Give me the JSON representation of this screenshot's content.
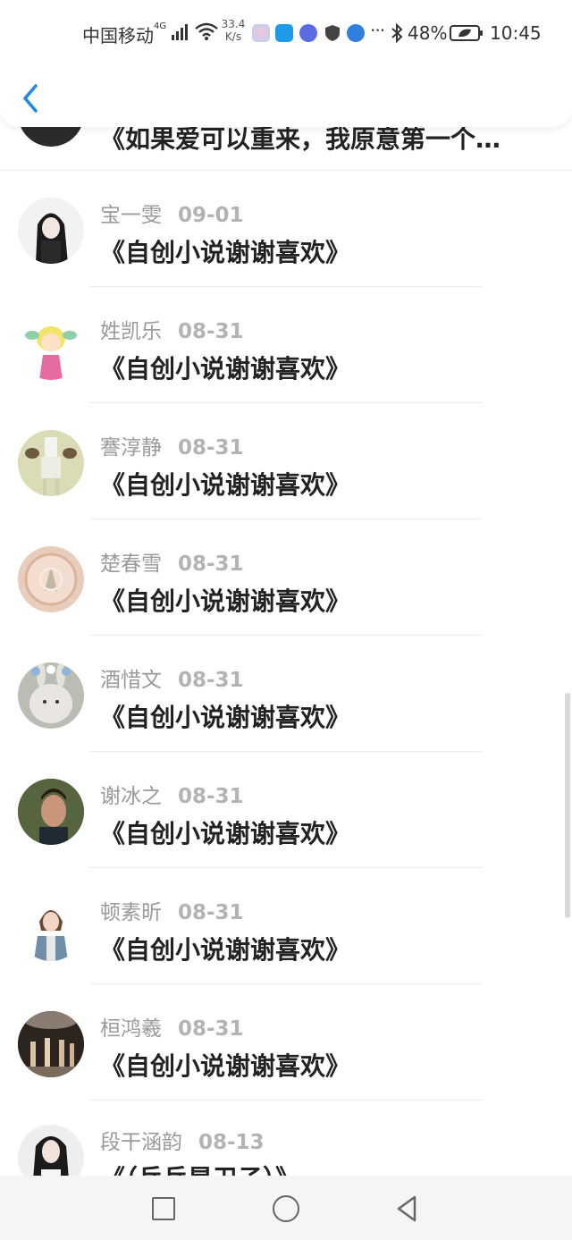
{
  "status_bar": {
    "carrier": "中国移动",
    "network_type": "4G",
    "net_speed_value": "33.4",
    "net_speed_unit": "K/s",
    "ellipsis": "···",
    "battery": "48%",
    "time": "10:45"
  },
  "header": {
    "back_icon": "chevron-left-icon"
  },
  "first_row": {
    "title": "《如果爱可以重来，我原意第一个…"
  },
  "rows": [
    {
      "name": "宝一雯",
      "date": "09-01",
      "title": "《自创小说谢谢喜欢》"
    },
    {
      "name": "姓凯乐",
      "date": "08-31",
      "title": "《自创小说谢谢喜欢》"
    },
    {
      "name": "謇淳静",
      "date": "08-31",
      "title": "《自创小说谢谢喜欢》"
    },
    {
      "name": "楚春雪",
      "date": "08-31",
      "title": "《自创小说谢谢喜欢》"
    },
    {
      "name": "酒惜文",
      "date": "08-31",
      "title": "《自创小说谢谢喜欢》"
    },
    {
      "name": "谢冰之",
      "date": "08-31",
      "title": "《自创小说谢谢喜欢》"
    },
    {
      "name": "顿素昕",
      "date": "08-31",
      "title": "《自创小说谢谢喜欢》"
    },
    {
      "name": "桓鸿羲",
      "date": "08-31",
      "title": "《自创小说谢谢喜欢》"
    },
    {
      "name": "段干涵韵",
      "date": "08-13",
      "title": "《（乒乓是卫子）》"
    }
  ],
  "colors": {
    "accent": "#1e88e5",
    "name_gray": "#9a9a9a",
    "title_dark": "#222222"
  },
  "nav_bar": {
    "recent_icon": "square-icon",
    "home_icon": "circle-icon",
    "back_icon": "triangle-back-icon"
  }
}
